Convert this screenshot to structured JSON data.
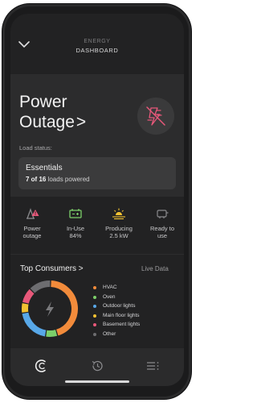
{
  "header": {
    "app_label": "ENERGY",
    "title": "DASHBOARD"
  },
  "outage": {
    "title_line1": "Power",
    "title_line2": "Outage",
    "chevron": ">",
    "load_status_label": "Load status:",
    "essentials": {
      "title": "Essentials",
      "count_bold": "7 of 16",
      "count_suffix": "loads powered"
    }
  },
  "status": [
    {
      "label_line1": "Power",
      "label_line2": "outage",
      "icon": "power-warning-icon"
    },
    {
      "label_line1": "In-Use",
      "label_line2": "84%",
      "icon": "battery-icon"
    },
    {
      "label_line1": "Producing",
      "label_line2": "2.5 kW",
      "icon": "solar-sun-icon"
    },
    {
      "label_line1": "Ready to",
      "label_line2": "use",
      "icon": "ev-charger-icon"
    }
  ],
  "consumers": {
    "title": "Top Consumers >",
    "live_label": "Live Data",
    "items": [
      {
        "label": "HVAC",
        "color": "#f28b3b",
        "share": 0.45
      },
      {
        "label": "Oven",
        "color": "#7ccf6a",
        "share": 0.07
      },
      {
        "label": "Outdoor lights",
        "color": "#58a8e8",
        "share": 0.2
      },
      {
        "label": "Main floor lights",
        "color": "#f2c232",
        "share": 0.06
      },
      {
        "label": "Basement lights",
        "color": "#e8587a",
        "share": 0.09
      },
      {
        "label": "Other",
        "color": "#6d6d70",
        "share": 0.13
      }
    ]
  },
  "colors": {
    "accent": "#f28b3b",
    "alert": "#e8587a",
    "good": "#7ccf6a"
  }
}
